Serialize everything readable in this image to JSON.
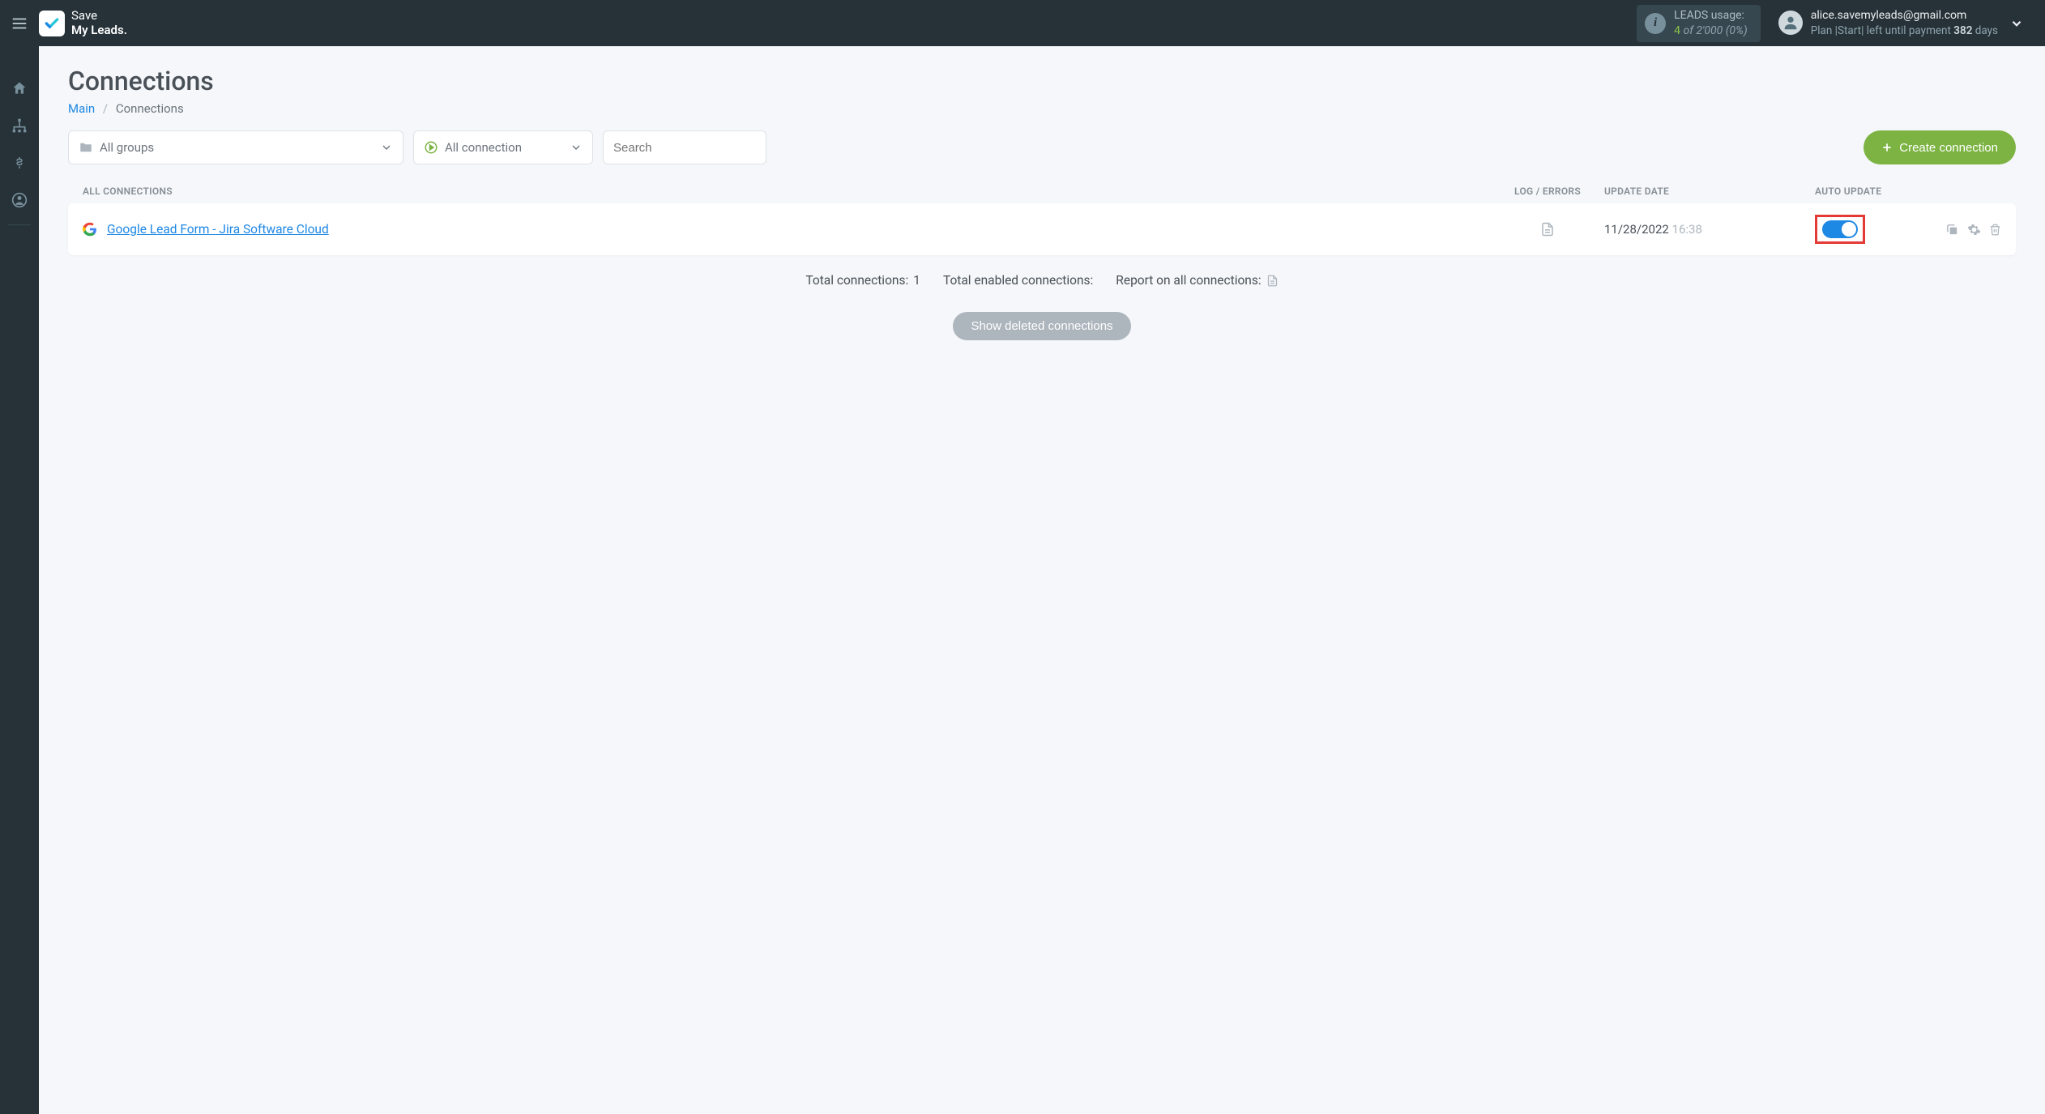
{
  "brand": {
    "line1": "Save",
    "line2": "My Leads."
  },
  "usage": {
    "label": "LEADS usage:",
    "used": "4",
    "of_word": "of",
    "limit": "2'000",
    "percent": "(0%)"
  },
  "user": {
    "email": "alice.savemyleads@gmail.com",
    "plan_prefix": "Plan ",
    "plan_name": "|Start|",
    "plan_suffix_pre": " left until payment ",
    "days": "382",
    "days_word": " days"
  },
  "page": {
    "title": "Connections"
  },
  "breadcrumb": {
    "main": "Main",
    "current": "Connections"
  },
  "filters": {
    "groups": "All groups",
    "connection": "All connection",
    "search_placeholder": "Search"
  },
  "create_button": "Create connection",
  "columns": {
    "all": "ALL CONNECTIONS",
    "log": "LOG / ERRORS",
    "date": "UPDATE DATE",
    "auto": "AUTO UPDATE"
  },
  "rows": [
    {
      "name": "Google Lead Form - Jira Software Cloud",
      "date": "11/28/2022",
      "time": "16:38",
      "auto_update": true
    }
  ],
  "summary": {
    "total_connections_label": "Total connections: ",
    "total_connections_value": "1",
    "total_enabled_label": "Total enabled connections:",
    "report_label": "Report on all connections:"
  },
  "show_deleted": "Show deleted connections"
}
